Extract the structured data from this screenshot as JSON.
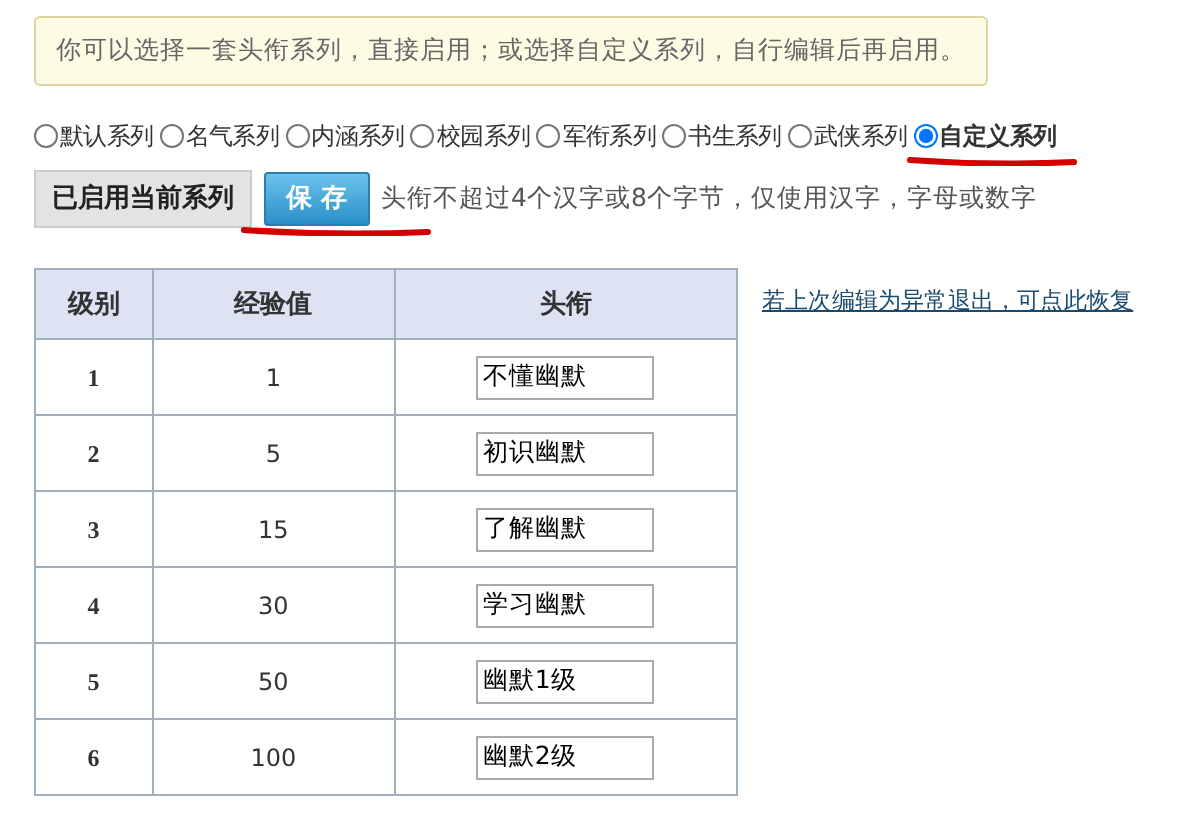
{
  "notice": "你可以选择一套头衔系列，直接启用；或选择自定义系列，自行编辑后再启用。",
  "series": [
    {
      "label": "默认系列",
      "selected": false,
      "underlined": false
    },
    {
      "label": "名气系列",
      "selected": false,
      "underlined": false
    },
    {
      "label": "内涵系列",
      "selected": false,
      "underlined": false
    },
    {
      "label": "校园系列",
      "selected": false,
      "underlined": false
    },
    {
      "label": "军衔系列",
      "selected": false,
      "underlined": false
    },
    {
      "label": "书生系列",
      "selected": false,
      "underlined": false
    },
    {
      "label": "武侠系列",
      "selected": false,
      "underlined": false
    },
    {
      "label": "自定义系列",
      "selected": true,
      "underlined": true
    }
  ],
  "enabled_button": "已启用当前系列",
  "save_button": {
    "label": "保 存",
    "underlined": true
  },
  "hint": "头衔不超过4个汉字或8个字节，仅使用汉字，字母或数字",
  "table": {
    "columns": [
      "级别",
      "经验值",
      "头衔"
    ],
    "rows": [
      {
        "level": "1",
        "exp": "1",
        "title": "不懂幽默"
      },
      {
        "level": "2",
        "exp": "5",
        "title": "初识幽默"
      },
      {
        "level": "3",
        "exp": "15",
        "title": "了解幽默"
      },
      {
        "level": "4",
        "exp": "30",
        "title": "学习幽默"
      },
      {
        "level": "5",
        "exp": "50",
        "title": "幽默1级"
      },
      {
        "level": "6",
        "exp": "100",
        "title": "幽默2级"
      }
    ]
  },
  "restore_link": "若上次编辑为异常退出，可点此恢复"
}
